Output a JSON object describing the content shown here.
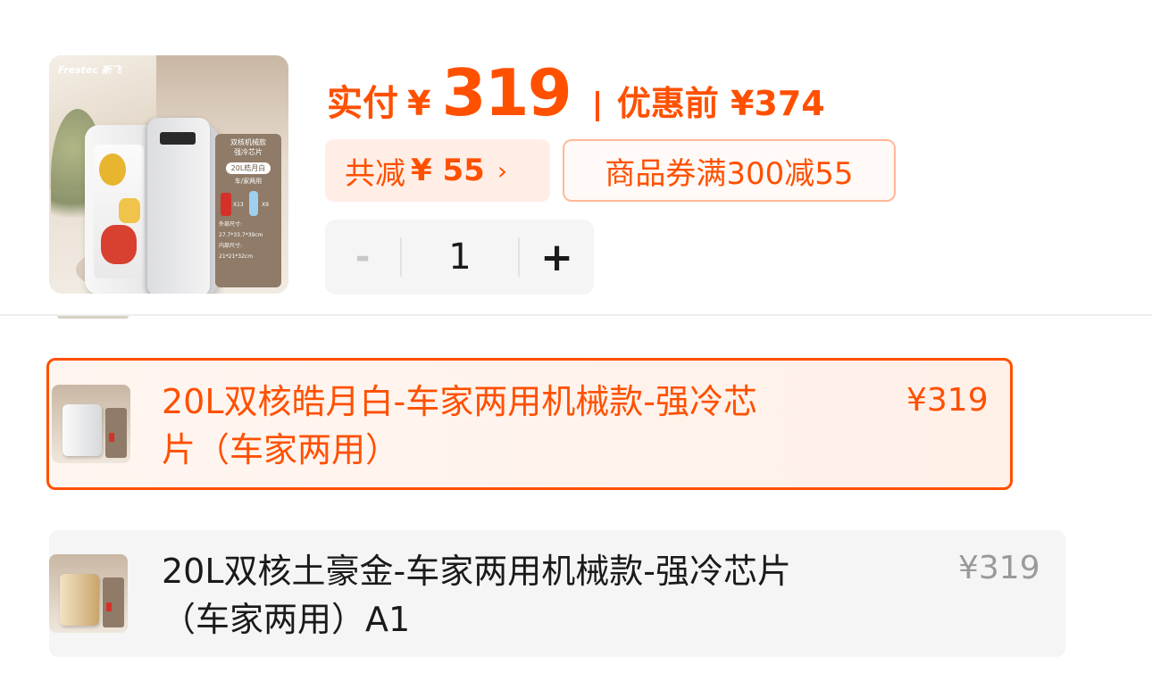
{
  "product": {
    "brand": "Frestec 新飞",
    "image_panel": {
      "title_line1": "双核机械款",
      "title_line2": "强冷芯片",
      "variant_pill": "20L皓月白",
      "usage": "车/家两用",
      "can_count": "X13",
      "bottle_count": "X9",
      "outer_label": "外部尺寸:",
      "outer_size": "27.7*33.7*39cm",
      "inner_label": "内部尺寸:",
      "inner_size": "21*21*32cm"
    }
  },
  "price": {
    "paid_label": "实付",
    "currency": "¥",
    "paid_value": "319",
    "before_label": "优惠前 ¥374"
  },
  "discount": {
    "label": "共减",
    "amount": "¥ 55",
    "chevron": "›"
  },
  "coupon": {
    "label": "商品券满300减55"
  },
  "quantity": {
    "minus": "-",
    "value": "1",
    "plus": "+"
  },
  "options": [
    {
      "line1": "20L双核皓月白-车家两用机械款-强冷芯",
      "line2": "片（车家两用）",
      "price": "¥319",
      "selected": true
    },
    {
      "line1": "20L双核土豪金-车家两用机械款-强冷芯片",
      "line2": "（车家两用）A1",
      "price": "¥319",
      "selected": false
    }
  ],
  "colors": {
    "accent": "#ff5000",
    "chip_bg": "#ffeee6",
    "stepper_bg": "#f5f5f5",
    "option_bg": "#f5f5f5",
    "muted_price": "#9a9a9a"
  }
}
